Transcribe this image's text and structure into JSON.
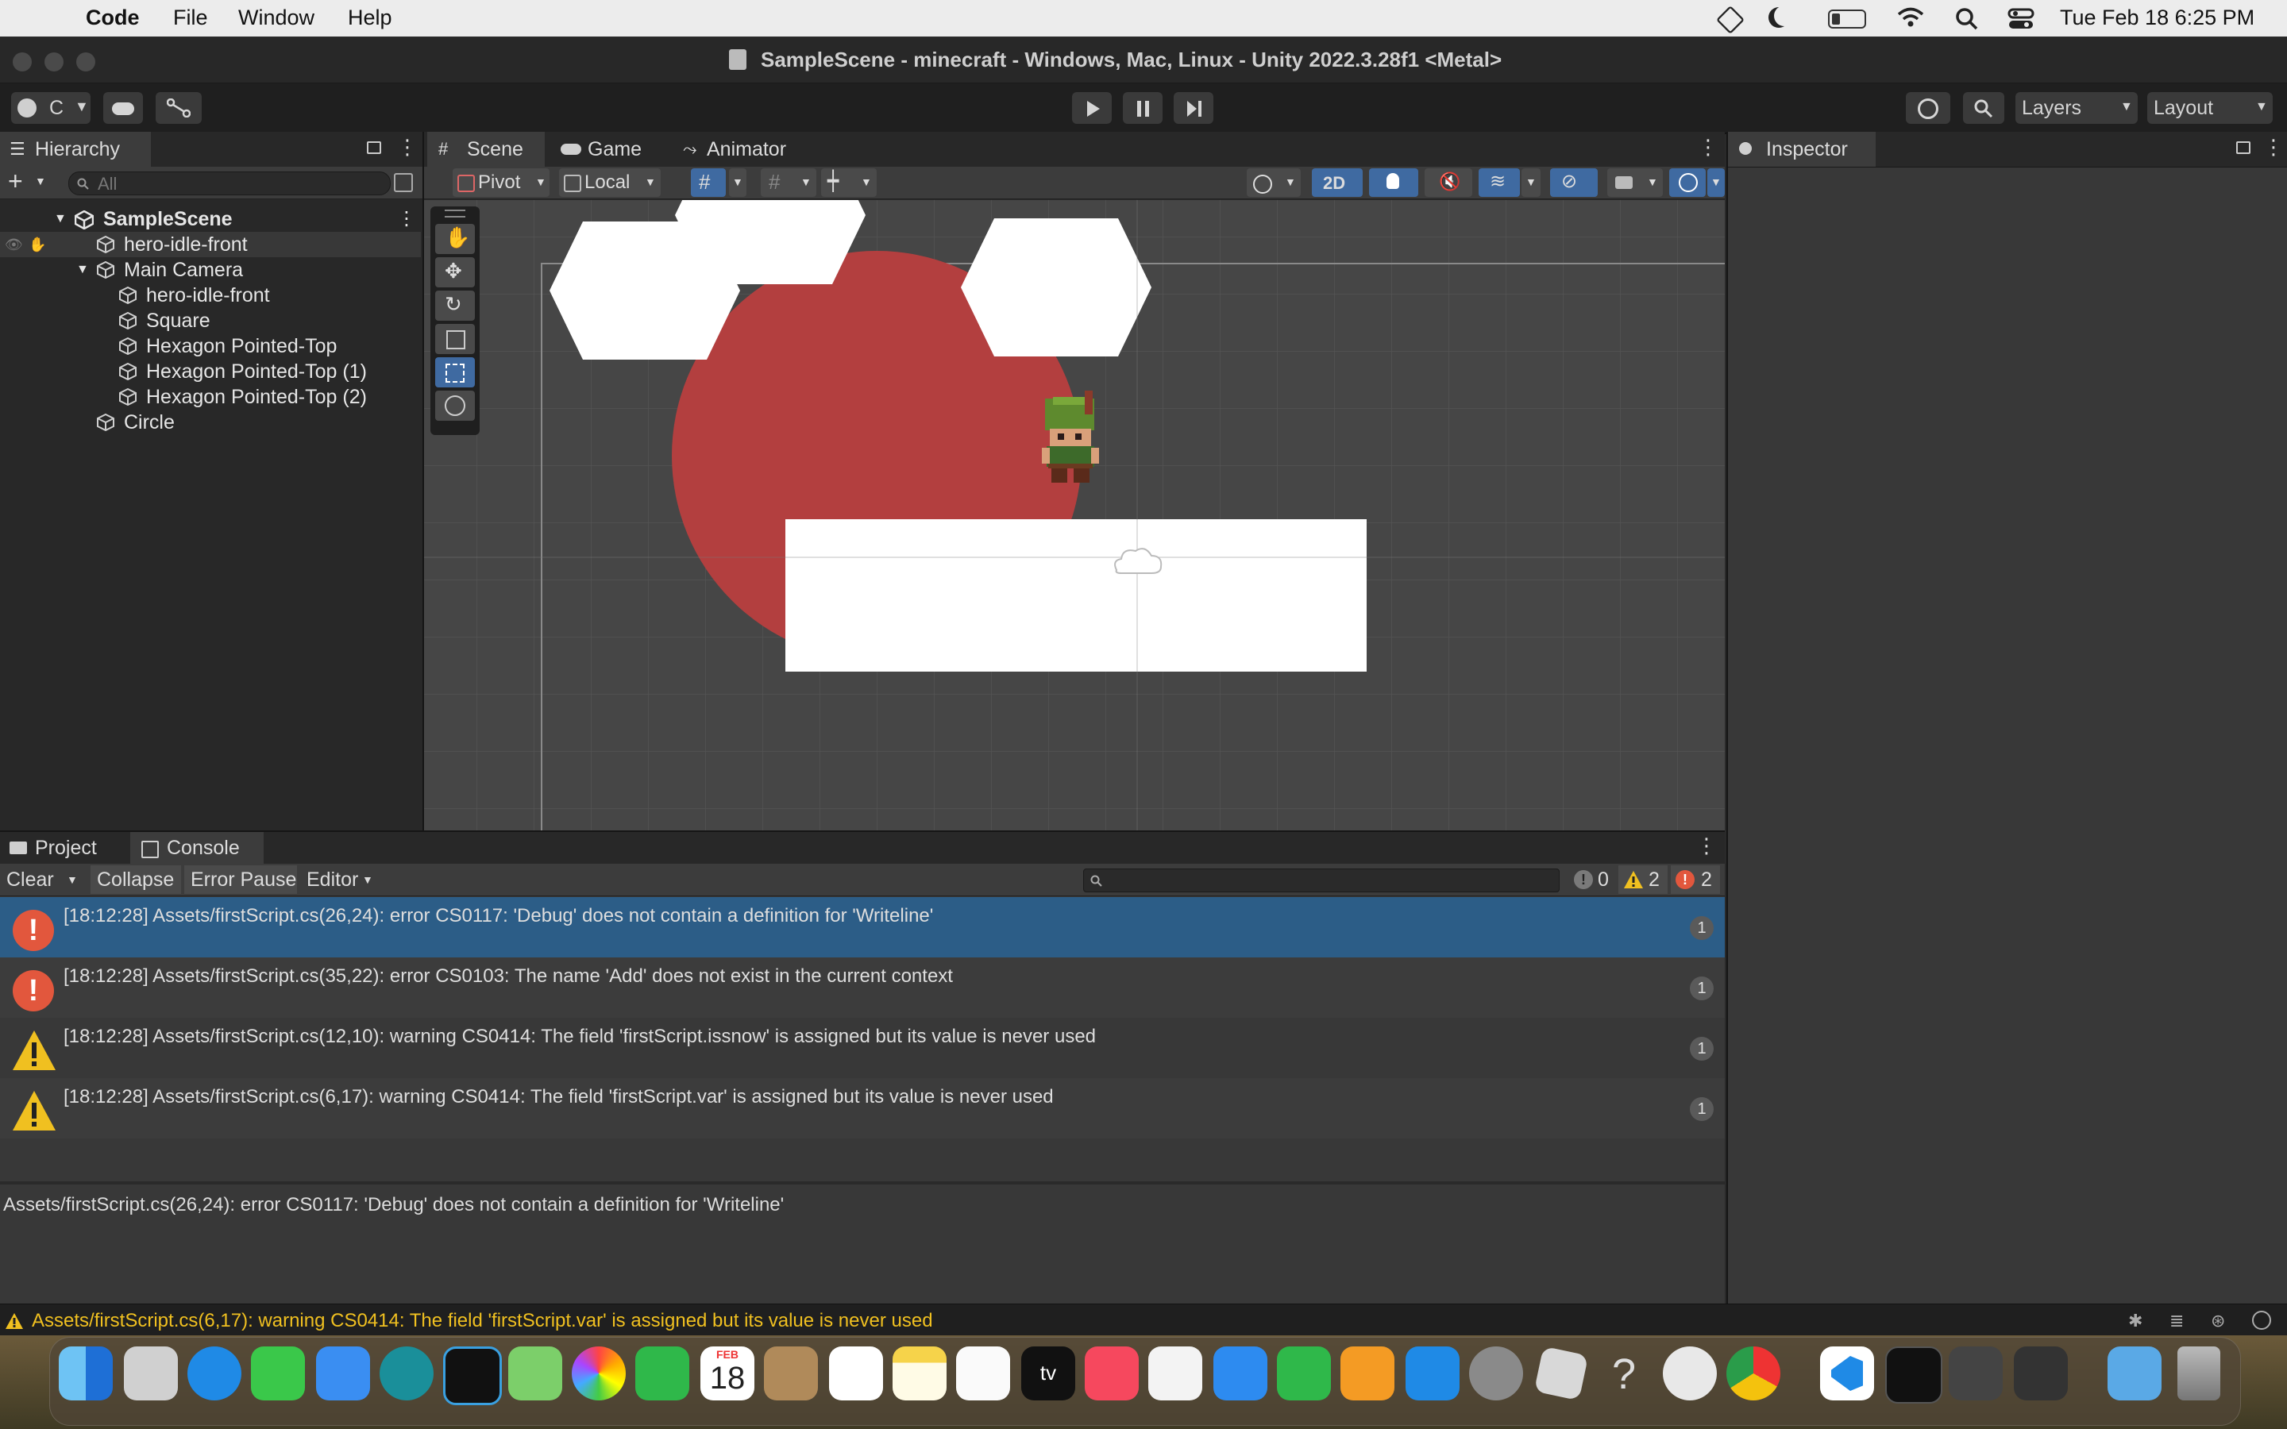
{
  "menubar": {
    "app_name": "Code",
    "items": [
      "File",
      "Window",
      "Help"
    ],
    "clock": "Tue Feb 18  6:25 PM"
  },
  "window": {
    "title": "SampleScene - minecraft - Windows, Mac, Linux - Unity 2022.3.28f1 <Metal>"
  },
  "toolbar": {
    "account_label": "C",
    "layers_label": "Layers",
    "layout_label": "Layout"
  },
  "hierarchy": {
    "tab_label": "Hierarchy",
    "search_placeholder": "All",
    "scene_name": "SampleScene",
    "items": [
      {
        "label": "hero-idle-front"
      },
      {
        "label": "Main Camera"
      },
      {
        "label": "hero-idle-front"
      },
      {
        "label": "Square"
      },
      {
        "label": "Hexagon Pointed-Top"
      },
      {
        "label": "Hexagon Pointed-Top (1)"
      },
      {
        "label": "Hexagon Pointed-Top (2)"
      },
      {
        "label": "Circle"
      }
    ]
  },
  "scene": {
    "tabs": [
      "Scene",
      "Game",
      "Animator"
    ],
    "pivot_label": "Pivot",
    "local_label": "Local",
    "mode_2d_label": "2D"
  },
  "inspector": {
    "tab_label": "Inspector"
  },
  "bottom": {
    "tabs": [
      "Project",
      "Console"
    ],
    "clear_label": "Clear",
    "collapse_label": "Collapse",
    "error_pause_label": "Error Pause",
    "editor_label": "Editor",
    "info_count": "0",
    "warning_count": "2",
    "error_count": "2",
    "rows": [
      {
        "type": "error",
        "text": "[18:12:28] Assets/firstScript.cs(26,24): error CS0117: 'Debug' does not contain a definition for 'Writeline'",
        "count": "1"
      },
      {
        "type": "error",
        "text": "[18:12:28] Assets/firstScript.cs(35,22): error CS0103: The name 'Add' does not exist in the current context",
        "count": "1"
      },
      {
        "type": "warning",
        "text": "[18:12:28] Assets/firstScript.cs(12,10): warning CS0414: The field 'firstScript.issnow' is assigned but its value is never used",
        "count": "1"
      },
      {
        "type": "warning",
        "text": "[18:12:28] Assets/firstScript.cs(6,17): warning CS0414: The field 'firstScript.var' is assigned but its value is never used",
        "count": "1"
      }
    ],
    "detail": "Assets/firstScript.cs(26,24): error CS0117: 'Debug' does not contain a definition for 'Writeline'"
  },
  "statusbar": {
    "text": "Assets/firstScript.cs(6,17): warning CS0414: The field 'firstScript.var' is assigned but its value is never used"
  },
  "dock": {
    "calendar_month": "FEB",
    "calendar_day": "18",
    "tv_label": "tv",
    "apps": [
      "finder",
      "launchpad",
      "safari",
      "messages",
      "mail",
      "arduino",
      "unity-hub",
      "maps",
      "photos",
      "facetime",
      "calendar",
      "contacts",
      "reminders",
      "notes",
      "freeform",
      "apple-tv",
      "music",
      "news",
      "keynote",
      "numbers",
      "pages",
      "app-store",
      "system-settings",
      "roblox",
      "help",
      "blocked-app",
      "chrome",
      "vscode",
      "terminal",
      "unity",
      "unity-2",
      "downloads",
      "trash"
    ]
  },
  "colors": {
    "selection": "#2c5d87",
    "accent_blue": "#3f6aa1",
    "error": "#e2573d",
    "warning": "#f0c020",
    "circle_red": "#b33f3f"
  }
}
